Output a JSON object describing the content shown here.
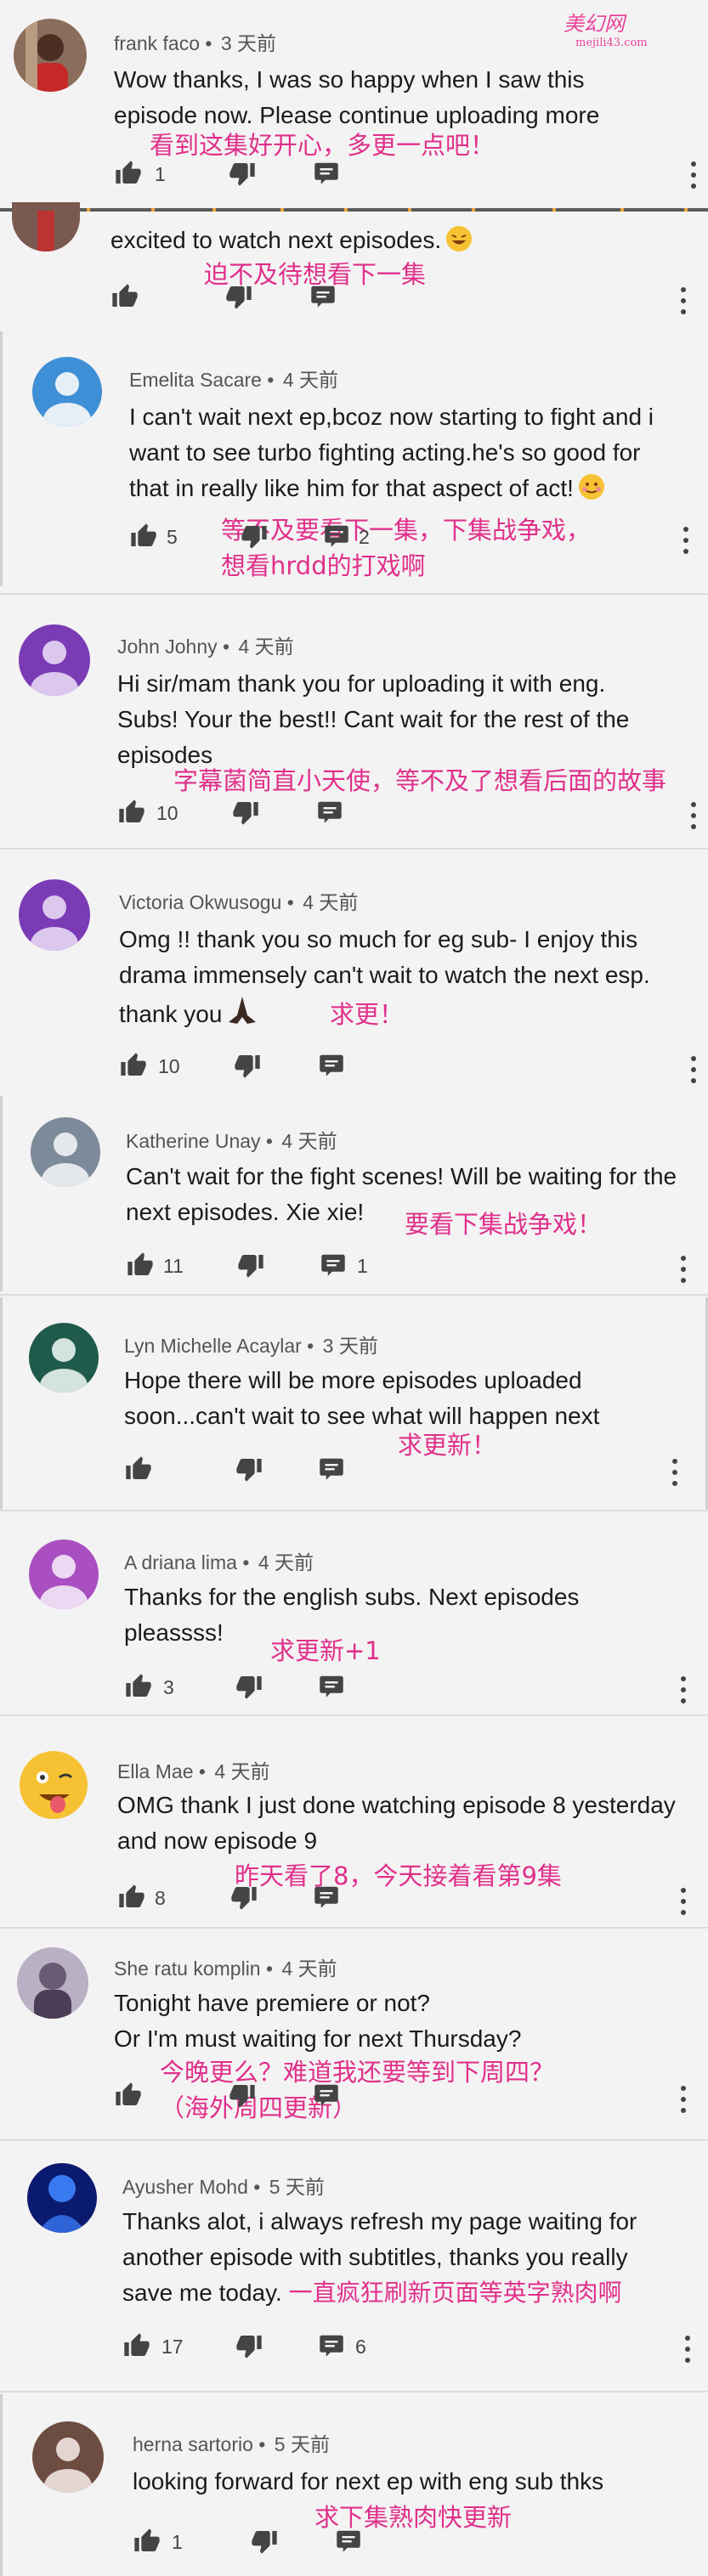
{
  "watermark": {
    "title": "美幻网",
    "site": "mejili43.com"
  },
  "comments": [
    {
      "author": "frank faco",
      "time": "3 天前",
      "text": "Wow thanks, I was so happy when I saw this episode now. Please continue uploading more",
      "likes": "1",
      "replies": "",
      "annotation": "看到这集好开心，多更一点吧！"
    },
    {
      "author": "",
      "time": "",
      "text": "excited to watch next episodes.",
      "likes": "",
      "replies": "",
      "annotation": "迫不及待想看下一集"
    },
    {
      "author": "Emelita Sacare",
      "time": "4 天前",
      "text": "I can't wait next ep,bcoz now starting to fight and i want to see turbo fighting acting.he's so good for that in really like him for that aspect of act!",
      "likes": "5",
      "replies": "2",
      "annotation": "等不及要看下一集，下集战争戏，\n想看hrdd的打戏啊"
    },
    {
      "author": "John Johny",
      "time": "4 天前",
      "text": "Hi sir/mam thank you for uploading it with eng. Subs! Your the best!! Cant wait for the rest of the episodes",
      "likes": "10",
      "replies": "",
      "annotation": "字幕菌简直小天使，等不及了想看后面的故事"
    },
    {
      "author": "Victoria Okwusogu",
      "time": "4 天前",
      "text": "Omg !! thank you so much for eg sub- I enjoy this drama immensely can't wait to watch the next esp. thank you",
      "likes": "10",
      "replies": "",
      "annotation": "求更！"
    },
    {
      "author": "Katherine Unay",
      "time": "4 天前",
      "text": "Can't wait for the fight scenes! Will be waiting for the next episodes. Xie xie!",
      "likes": "11",
      "replies": "1",
      "annotation": "要看下集战争戏！"
    },
    {
      "author": "Lyn Michelle Acaylar",
      "time": "3 天前",
      "text": "Hope there will be more episodes uploaded soon...can't wait to see what will happen next",
      "likes": "",
      "replies": "",
      "annotation": "求更新！"
    },
    {
      "author": "A driana lima",
      "time": "4 天前",
      "text": "Thanks for the english subs. Next episodes pleassss!",
      "likes": "3",
      "replies": "",
      "annotation": "求更新+1"
    },
    {
      "author": "Ella Mae",
      "time": "4 天前",
      "text": "OMG thank I just done watching episode 8 yesterday and now episode 9",
      "likes": "8",
      "replies": "",
      "annotation": "昨天看了8，今天接着看第9集"
    },
    {
      "author": "She ratu komplin",
      "time": "4 天前",
      "text": "Tonight have premiere or not?\nOr I'm must waiting for next Thursday?",
      "likes": "",
      "replies": "",
      "annotation": "今晚更么？难道我还要等到下周四？\n（海外周四更新）"
    },
    {
      "author": "Ayusher Mohd",
      "time": "5 天前",
      "text": "Thanks alot, i always refresh my page waiting for another episode with subtitles, thanks you really save me today.",
      "likes": "17",
      "replies": "6",
      "annotation": "一直疯狂刷新页面等英字熟肉啊"
    },
    {
      "author": "herna sartorio",
      "time": "5 天前",
      "text": "looking forward for next ep with eng sub thks",
      "likes": "1",
      "replies": "",
      "annotation": "求下集熟肉快更新"
    }
  ],
  "icons": {
    "like": "thumbs-up-icon",
    "dislike": "thumbs-down-icon",
    "reply": "comment-icon",
    "more": "more-vert-icon"
  },
  "colors": {
    "annotation": "#e0308a",
    "background": "#f4f3f4"
  }
}
